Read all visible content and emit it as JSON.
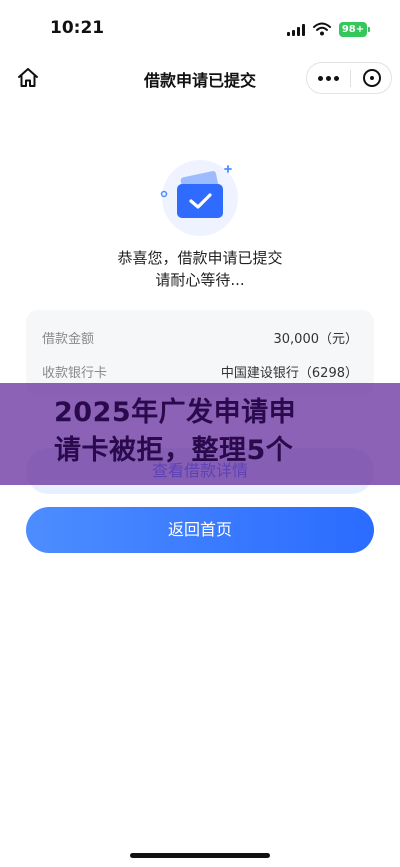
{
  "status_bar": {
    "time": "10:21",
    "battery": "98+",
    "icons": [
      "cellular-signal-icon",
      "wifi-icon",
      "battery-icon"
    ]
  },
  "nav": {
    "title": "借款申请已提交",
    "left_icon": "home-icon",
    "right_icons": [
      "more-icon",
      "close-miniprogram-icon"
    ]
  },
  "success": {
    "icon": "card-check-icon",
    "line1": "恭喜您，借款申请已提交",
    "line2": "请耐心等待..."
  },
  "details": [
    {
      "label": "借款金额",
      "value": "30,000（元）"
    },
    {
      "label": "收款银行卡",
      "value": "中国建设银行（6298）"
    }
  ],
  "buttons": {
    "view_detail": "查看借款详情",
    "back_home": "返回首页"
  },
  "overlay": {
    "text": "2025年广发申请申\n请卡被拒，整理5个"
  },
  "colors": {
    "accent": "#2f6bff",
    "accent_light": "#e8efff",
    "battery": "#34c759",
    "overlay": "#6a36a0"
  }
}
